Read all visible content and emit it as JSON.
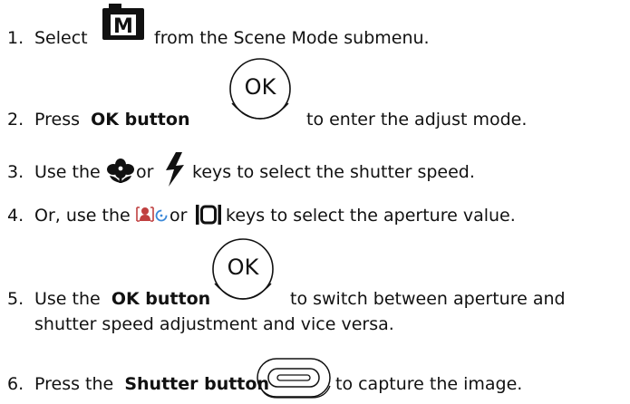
{
  "steps": [
    {
      "number": "1.",
      "before": "Select",
      "after": "from the Scene Mode submenu.",
      "icon": "manual-mode-icon",
      "icon_letter": "M"
    },
    {
      "number": "2.",
      "before": "Press",
      "bold": "OK button",
      "after": "to enter the adjust mode.",
      "icon": "ok-button-icon",
      "icon_label": "OK"
    },
    {
      "number": "3.",
      "before": "Use the",
      "middle": "or",
      "after": "keys to select the shutter speed.",
      "icon_a": "macro-flower-icon",
      "icon_b": "flash-icon"
    },
    {
      "number": "4.",
      "before": "Or, use the",
      "middle": "or",
      "after": "keys to select the aperture value.",
      "icon_a": "self-timer-icon",
      "icon_b": "display-icon"
    },
    {
      "number": "5.",
      "before": "Use the",
      "bold": "OK button",
      "after": "to switch between aperture and",
      "continuation": "shutter speed adjustment and vice versa.",
      "icon": "ok-button-icon",
      "icon_label": "OK"
    },
    {
      "number": "6.",
      "before": "Press the",
      "bold": "Shutter button",
      "after": "to capture the image.",
      "icon": "shutter-button-icon"
    }
  ]
}
